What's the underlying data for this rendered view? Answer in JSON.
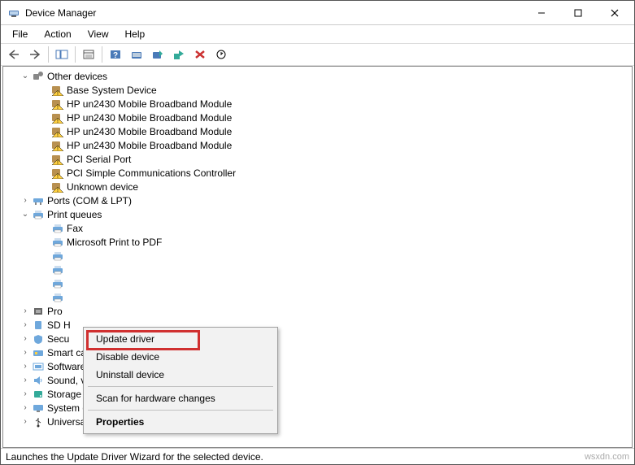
{
  "window": {
    "title": "Device Manager"
  },
  "menu": {
    "file": "File",
    "action": "Action",
    "view": "View",
    "help": "Help"
  },
  "tree": {
    "other_devices": {
      "label": "Other devices",
      "items": [
        "Base System Device",
        "HP un2430 Mobile Broadband Module",
        "HP un2430 Mobile Broadband Module",
        "HP un2430 Mobile Broadband Module",
        "HP un2430 Mobile Broadband Module",
        "PCI Serial Port",
        "PCI Simple Communications Controller",
        "Unknown device"
      ]
    },
    "ports": {
      "label": "Ports (COM & LPT)"
    },
    "print_queues": {
      "label": "Print queues",
      "items": [
        "Fax",
        "Microsoft Print to PDF",
        "",
        "",
        "",
        ""
      ]
    },
    "processors": {
      "label": "Pro"
    },
    "sd_host": {
      "label": "SD H"
    },
    "security": {
      "label": "Secu"
    },
    "smart_card": {
      "label": "Smart card readers"
    },
    "software": {
      "label": "Software devices"
    },
    "sound": {
      "label": "Sound, video and game controllers"
    },
    "storage": {
      "label": "Storage controllers"
    },
    "system": {
      "label": "System devices"
    },
    "usb": {
      "label": "Universal Serial Bus controllers"
    }
  },
  "context_menu": {
    "update": "Update driver",
    "disable": "Disable device",
    "uninstall": "Uninstall device",
    "scan": "Scan for hardware changes",
    "properties": "Properties"
  },
  "status": {
    "text": "Launches the Update Driver Wizard for the selected device."
  },
  "watermark": "wsxdn.com"
}
